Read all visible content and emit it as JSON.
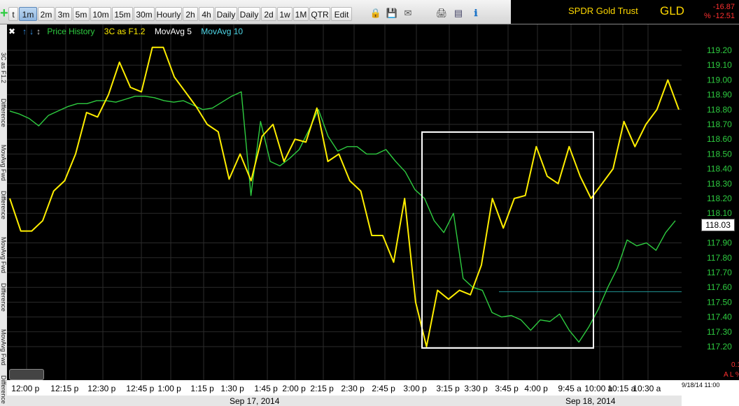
{
  "toolbar": {
    "timeframes": [
      "t",
      "1m",
      "2m",
      "3m",
      "5m",
      "10m",
      "15m",
      "30m",
      "Hourly",
      "2h",
      "4h",
      "Daily",
      "Daily",
      "2d",
      "1w",
      "1M",
      "QTR",
      "Edit"
    ],
    "active": "1m",
    "icons": [
      "plus-icon",
      "lock-icon",
      "save-icon",
      "email-icon",
      "print-icon",
      "card-icon",
      "info-icon"
    ]
  },
  "symbol": {
    "name": "SPDR Gold Trust",
    "ticker": "GLD",
    "change1": "-16.87",
    "change2": "% -12.51"
  },
  "legend": {
    "price_history": "Price History",
    "indicator": "3C as F1.2",
    "ma5": "MovAvg 5",
    "ma10": "MovAvg 10"
  },
  "left_tabs": [
    "3C as F1.2",
    "Difference",
    "MovAvg Fwd",
    "Difference",
    "MovAvg Fwd",
    "Difference",
    "MovAvg Fwd",
    "Difference"
  ],
  "current_price": "118.03",
  "indicator_scale": {
    "top": "0.10",
    "label": "A L % X"
  },
  "footer_timestamp": "9/18/14 11:00",
  "colors": {
    "price": "#2ecc40",
    "indicator": "#ffee00",
    "box": "#ffffff",
    "level_line": "#1f8f8f"
  },
  "chart_data": {
    "type": "line",
    "y_ticks": [
      "119.20",
      "119.10",
      "119.00",
      "118.90",
      "118.80",
      "118.70",
      "118.60",
      "118.50",
      "118.40",
      "118.30",
      "118.20",
      "118.10",
      "117.90",
      "117.80",
      "117.70",
      "117.60",
      "117.50",
      "117.40",
      "117.30",
      "117.20"
    ],
    "x_ticks": [
      "12:00 p",
      "12:15 p",
      "12:30 p",
      "12:45 p",
      "1:00 p",
      "1:15 p",
      "1:30 p",
      "1:45 p",
      "2:00 p",
      "2:15 p",
      "2:30 p",
      "2:45 p",
      "3:00 p",
      "3:15 p",
      "3:30 p",
      "3:45 p",
      "4:00 p",
      "9:45 a",
      "10:00 a",
      "10:15 a",
      "10:30 a"
    ],
    "dates": [
      "Sep 17, 2014",
      "Sep 18, 2014"
    ],
    "ylim": [
      117.15,
      119.25
    ],
    "series": [
      {
        "name": "Price History",
        "values": [
          118.79,
          118.77,
          118.74,
          118.69,
          118.76,
          118.79,
          118.82,
          118.84,
          118.84,
          118.86,
          118.86,
          118.85,
          118.87,
          118.89,
          118.89,
          118.88,
          118.86,
          118.85,
          118.86,
          118.83,
          118.8,
          118.81,
          118.85,
          118.89,
          118.92,
          118.22,
          118.72,
          118.45,
          118.42,
          118.47,
          118.53,
          118.66,
          118.8,
          118.62,
          118.52,
          118.55,
          118.55,
          118.5,
          118.5,
          118.53,
          118.45,
          118.38,
          118.26,
          118.2,
          118.05,
          117.97,
          118.1,
          117.66,
          117.6,
          117.58,
          117.43,
          117.4,
          117.41,
          117.38,
          117.31,
          117.38,
          117.37,
          117.42,
          117.31,
          117.23,
          117.33,
          117.45,
          117.6,
          117.73,
          117.92,
          117.88,
          117.9,
          117.85,
          117.97,
          118.05
        ]
      },
      {
        "name": "3C as F1.2",
        "values": [
          118.2,
          117.98,
          117.98,
          118.05,
          118.25,
          118.32,
          118.5,
          118.78,
          118.75,
          118.9,
          119.12,
          118.95,
          118.92,
          119.22,
          119.22,
          119.02,
          118.92,
          118.82,
          118.7,
          118.65,
          118.33,
          118.5,
          118.32,
          118.62,
          118.7,
          118.45,
          118.6,
          118.58,
          118.81,
          118.45,
          118.5,
          118.32,
          118.25,
          117.95,
          117.95,
          117.77,
          118.2,
          117.5,
          117.2,
          117.58,
          117.52,
          117.58,
          117.55,
          117.75,
          118.2,
          118.0,
          118.2,
          118.22,
          118.55,
          118.35,
          118.3,
          118.55,
          118.35,
          118.2,
          118.3,
          118.4,
          118.72,
          118.55,
          118.7,
          118.8,
          119.0,
          118.8
        ]
      }
    ],
    "level_value": 117.57
  }
}
